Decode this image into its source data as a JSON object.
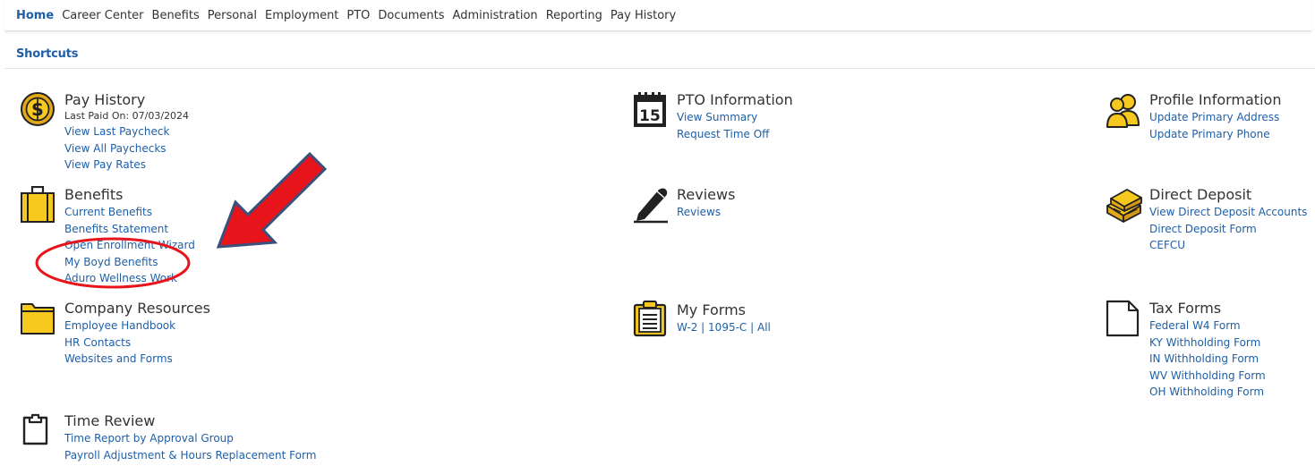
{
  "nav": {
    "items": [
      "Home",
      "Career Center",
      "Benefits",
      "Personal",
      "Employment",
      "PTO",
      "Documents",
      "Administration",
      "Reporting",
      "Pay History"
    ]
  },
  "shortcuts": {
    "title": "Shortcuts"
  },
  "blocks": {
    "pay_history": {
      "title": "Pay History",
      "note": "Last Paid On: 07/03/2024",
      "links": [
        "View Last Paycheck",
        "View All Paychecks",
        "View Pay Rates"
      ]
    },
    "benefits": {
      "title": "Benefits",
      "links": [
        "Current Benefits",
        "Benefits Statement",
        "Open Enrollment Wizard",
        "My Boyd Benefits",
        "Aduro Wellness Work"
      ]
    },
    "company_resources": {
      "title": "Company Resources",
      "links": [
        "Employee Handbook",
        "HR Contacts",
        "Websites and Forms"
      ]
    },
    "time_review": {
      "title": "Time Review",
      "links": [
        "Time Report by Approval Group",
        "Payroll Adjustment & Hours Replacement Form"
      ]
    },
    "pto_information": {
      "title": "PTO Information",
      "calendar_day": "15",
      "links": [
        "View Summary",
        "Request Time Off"
      ]
    },
    "reviews": {
      "title": "Reviews",
      "links": [
        "Reviews"
      ]
    },
    "my_forms": {
      "title": "My Forms",
      "links": [
        "W-2",
        "1095-C",
        "All"
      ],
      "separator": "|"
    },
    "profile_information": {
      "title": "Profile Information",
      "links": [
        "Update Primary Address",
        "Update Primary Phone"
      ]
    },
    "direct_deposit": {
      "title": "Direct Deposit",
      "links": [
        "View Direct Deposit Accounts",
        "Direct Deposit Form",
        "CEFCU"
      ]
    },
    "tax_forms": {
      "title": "Tax Forms",
      "links": [
        "Federal W4 Form",
        "KY Withholding Form",
        "IN Withholding Form",
        "WV Withholding Form",
        "OH Withholding Form"
      ]
    }
  },
  "icons": {
    "pay_history": "dollar-coin-icon",
    "benefits": "briefcase-icon",
    "company_resources": "folder-icon",
    "time_review": "clipboard-icon",
    "pto_information": "calendar-icon",
    "reviews": "pen-icon",
    "my_forms": "document-list-icon",
    "profile_information": "users-icon",
    "direct_deposit": "money-stack-icon",
    "tax_forms": "blank-document-icon"
  },
  "colors": {
    "accent": "#1e5fa8",
    "icon_yellow": "#f7c81e",
    "annotation_red": "#e8141b"
  }
}
